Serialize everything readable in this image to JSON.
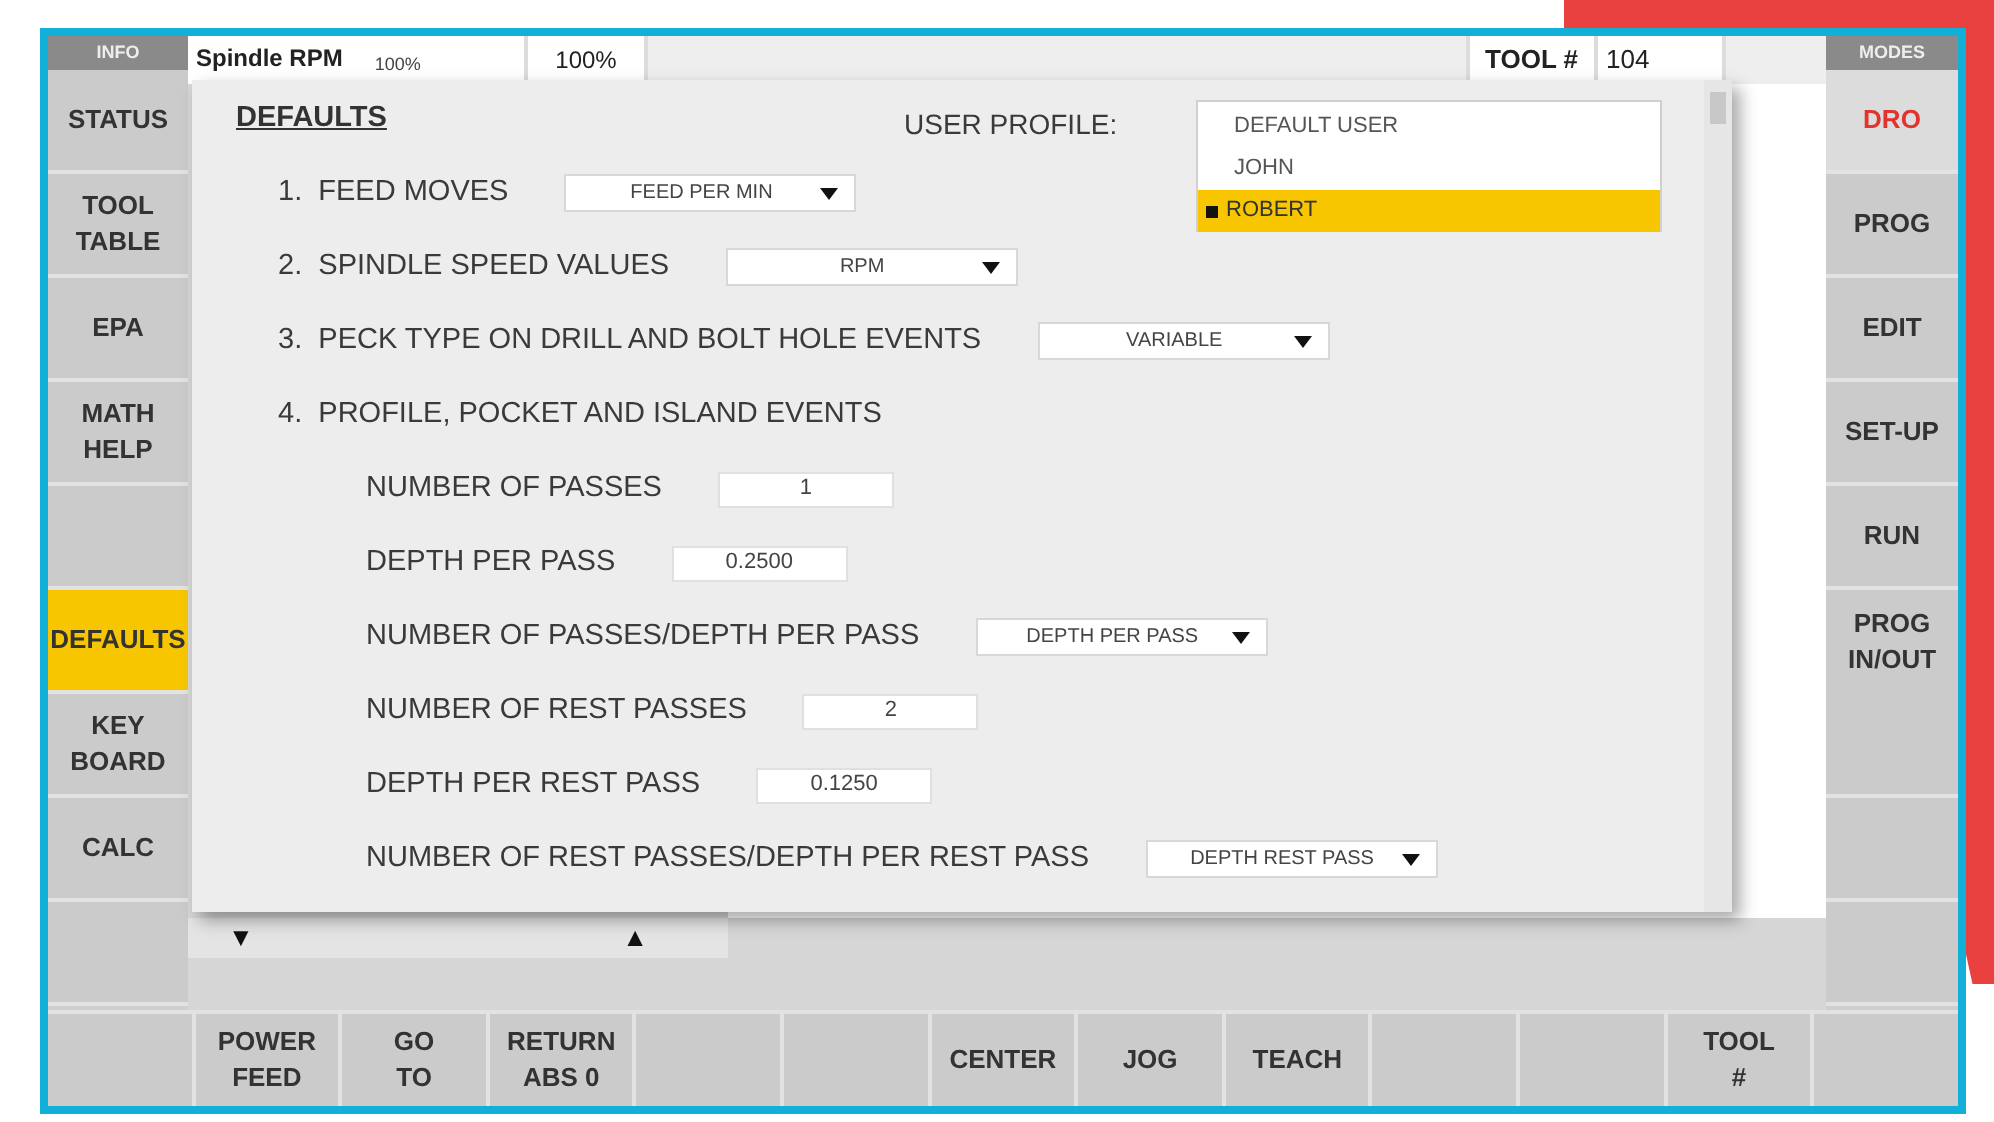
{
  "info_label": "INFO",
  "modes_label": "MODES",
  "top_bar": {
    "spindle_label": "Spindle RPM",
    "spindle_value": "100%",
    "override": "100%",
    "tool_label": "TOOL #",
    "tool_value": "104"
  },
  "left_menu": [
    {
      "lines": [
        "STATUS"
      ],
      "selected": false
    },
    {
      "lines": [
        "TOOL",
        "TABLE"
      ],
      "selected": false
    },
    {
      "lines": [
        "EPA"
      ],
      "selected": false
    },
    {
      "lines": [
        "MATH",
        "HELP"
      ],
      "selected": false
    },
    {
      "kind": "blank"
    },
    {
      "lines": [
        "DEFAULTS"
      ],
      "selected": true
    },
    {
      "lines": [
        "KEY",
        "BOARD"
      ],
      "selected": false
    },
    {
      "lines": [
        "CALC"
      ],
      "selected": false
    },
    {
      "kind": "blank"
    }
  ],
  "right_menu": [
    {
      "lines": [
        "DRO"
      ],
      "selected": true
    },
    {
      "lines": [
        "PROG"
      ],
      "selected": false
    },
    {
      "lines": [
        "EDIT"
      ],
      "selected": false
    },
    {
      "lines": [
        "SET-UP"
      ],
      "selected": false
    },
    {
      "lines": [
        "RUN"
      ],
      "selected": false
    },
    {
      "kind": "tall",
      "lines": [
        "PROG",
        "IN/OUT"
      ],
      "selected": false
    },
    {
      "kind": "blank"
    },
    {
      "kind": "blank"
    }
  ],
  "dialog": {
    "title": "DEFAULTS",
    "profile_label": "USER PROFILE:",
    "profiles": [
      {
        "name": "DEFAULT USER",
        "selected": false
      },
      {
        "name": "JOHN",
        "selected": false
      },
      {
        "name": "ROBERT",
        "selected": true
      }
    ],
    "settings": [
      {
        "kind": "select",
        "label": "1.  FEED MOVES",
        "value": "FEED PER MIN"
      },
      {
        "kind": "select",
        "label": "2.  SPINDLE SPEED VALUES",
        "value": "RPM"
      },
      {
        "kind": "select",
        "label": "3.  PECK TYPE ON DRILL AND BOLT HOLE EVENTS",
        "value": "VARIABLE"
      },
      {
        "kind": "heading",
        "label": "4.  PROFILE, POCKET AND ISLAND EVENTS",
        "children": [
          {
            "kind": "input",
            "label": "NUMBER OF PASSES",
            "value": "1"
          },
          {
            "kind": "input",
            "label": "DEPTH PER PASS",
            "value": "0.2500"
          },
          {
            "kind": "select",
            "label": "NUMBER OF PASSES/DEPTH PER PASS",
            "value": "DEPTH PER PASS"
          },
          {
            "kind": "input",
            "label": "NUMBER OF REST PASSES",
            "value": "2"
          },
          {
            "kind": "input",
            "label": "DEPTH PER REST PASS",
            "value": "0.1250"
          },
          {
            "kind": "select",
            "label": "NUMBER OF REST PASSES/DEPTH PER REST PASS",
            "value": "DEPTH REST PASS"
          }
        ]
      }
    ]
  },
  "jog_bar": {
    "down": "▼",
    "up": "▲"
  },
  "bottom_bar": [
    {
      "kind": "blank"
    },
    {
      "lines": [
        "POWER",
        "FEED"
      ]
    },
    {
      "lines": [
        "GO",
        "TO"
      ]
    },
    {
      "lines": [
        "RETURN",
        "ABS 0"
      ]
    },
    {
      "kind": "blank"
    },
    {
      "kind": "blank"
    },
    {
      "lines": [
        "CENTER"
      ]
    },
    {
      "lines": [
        "JOG"
      ]
    },
    {
      "lines": [
        "TEACH"
      ]
    },
    {
      "kind": "blank"
    },
    {
      "kind": "blank"
    },
    {
      "lines": [
        "TOOL",
        "#"
      ]
    },
    {
      "kind": "blank"
    }
  ]
}
